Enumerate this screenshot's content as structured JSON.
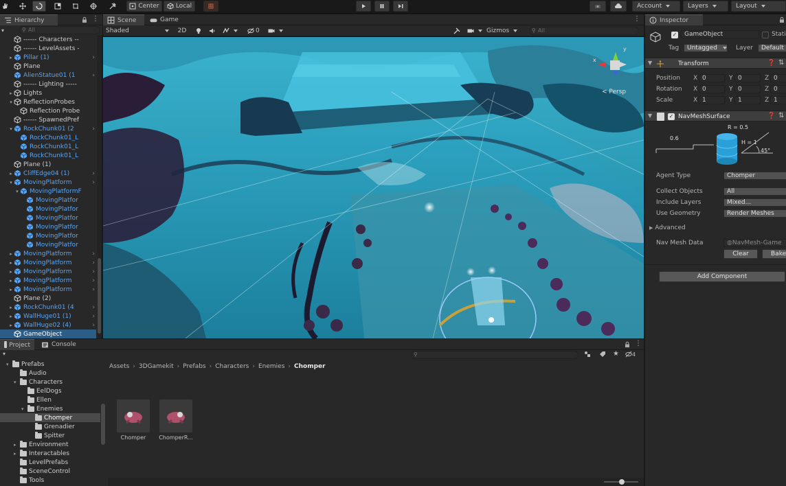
{
  "toolbar": {
    "center_label": "Center",
    "local_label": "Local",
    "account_label": "Account",
    "layers_label": "Layers",
    "layout_label": "Layout"
  },
  "hierarchy": {
    "tab_label": "Hierarchy",
    "search_placeholder": "All",
    "items": [
      {
        "label": "------ Characters --",
        "indent": 2,
        "blue": false,
        "arrow": ""
      },
      {
        "label": "------ LevelAssets -",
        "indent": 2,
        "blue": false,
        "arrow": ""
      },
      {
        "label": "Pillar (1)",
        "indent": 2,
        "blue": true,
        "arrow": "▶",
        "chev": true
      },
      {
        "label": "Plane",
        "indent": 2,
        "blue": false,
        "arrow": ""
      },
      {
        "label": "AlienStatue01 (1",
        "indent": 2,
        "blue": true,
        "arrow": "",
        "chev": true
      },
      {
        "label": "------ Lighting -----",
        "indent": 2,
        "blue": false,
        "arrow": ""
      },
      {
        "label": "Lights",
        "indent": 2,
        "blue": false,
        "arrow": "▶"
      },
      {
        "label": "ReflectionProbes",
        "indent": 2,
        "blue": false,
        "arrow": "▼"
      },
      {
        "label": "Reflection Probe",
        "indent": 3,
        "blue": false,
        "arrow": ""
      },
      {
        "label": "------ SpawnedPref",
        "indent": 2,
        "blue": false,
        "arrow": ""
      },
      {
        "label": "RockChunk01 (2",
        "indent": 2,
        "blue": true,
        "arrow": "▼",
        "chev": true
      },
      {
        "label": "RockChunk01_L",
        "indent": 3,
        "blue": true,
        "arrow": ""
      },
      {
        "label": "RockChunk01_L",
        "indent": 3,
        "blue": true,
        "arrow": ""
      },
      {
        "label": "RockChunk01_L",
        "indent": 3,
        "blue": true,
        "arrow": ""
      },
      {
        "label": "Plane (1)",
        "indent": 2,
        "blue": false,
        "arrow": ""
      },
      {
        "label": "CliffEdge04 (1)",
        "indent": 2,
        "blue": true,
        "arrow": "▶",
        "chev": true
      },
      {
        "label": "MovingPlatform",
        "indent": 2,
        "blue": true,
        "arrow": "▼",
        "chev": true
      },
      {
        "label": "MovingPlatformF",
        "indent": 3,
        "blue": true,
        "arrow": "▼"
      },
      {
        "label": "MovingPlatfor",
        "indent": 4,
        "blue": true,
        "arrow": ""
      },
      {
        "label": "MovingPlatfor",
        "indent": 4,
        "blue": true,
        "arrow": ""
      },
      {
        "label": "MovingPlatfor",
        "indent": 4,
        "blue": true,
        "arrow": ""
      },
      {
        "label": "MovingPlatfor",
        "indent": 4,
        "blue": true,
        "arrow": ""
      },
      {
        "label": "MovingPlatfor",
        "indent": 4,
        "blue": true,
        "arrow": ""
      },
      {
        "label": "MovingPlatfor",
        "indent": 4,
        "blue": true,
        "arrow": ""
      },
      {
        "label": "MovingPlatform",
        "indent": 2,
        "blue": true,
        "arrow": "▶",
        "chev": true
      },
      {
        "label": "MovingPlatform",
        "indent": 2,
        "blue": true,
        "arrow": "▶",
        "chev": true
      },
      {
        "label": "MovingPlatform",
        "indent": 2,
        "blue": true,
        "arrow": "▶",
        "chev": true
      },
      {
        "label": "MovingPlatform",
        "indent": 2,
        "blue": true,
        "arrow": "▶",
        "chev": true
      },
      {
        "label": "MovingPlatform",
        "indent": 2,
        "blue": true,
        "arrow": "▶",
        "chev": true
      },
      {
        "label": "Plane (2)",
        "indent": 2,
        "blue": false,
        "arrow": ""
      },
      {
        "label": "RockChunk01 (4",
        "indent": 2,
        "blue": true,
        "arrow": "▶",
        "chev": true
      },
      {
        "label": "WallHuge01 (1)",
        "indent": 2,
        "blue": true,
        "arrow": "▶",
        "chev": true
      },
      {
        "label": "WallHuge02 (4)",
        "indent": 2,
        "blue": true,
        "arrow": "▶",
        "chev": true
      },
      {
        "label": "GameObject",
        "indent": 2,
        "blue": false,
        "arrow": "",
        "selected": true
      }
    ]
  },
  "scene": {
    "tab_scene": "Scene",
    "tab_game": "Game",
    "shading_mode": "Shaded",
    "mode_2d": "2D",
    "effects_count": "0",
    "gizmos_label": "Gizmos",
    "search_placeholder": "All",
    "persp_label": "< Persp",
    "gizmo_y": "y",
    "gizmo_x": "x"
  },
  "inspector": {
    "tab_label": "Inspector",
    "object_name": "GameObject",
    "static_label": "Stati",
    "tag_label": "Tag",
    "tag_value": "Untagged",
    "layer_label": "Layer",
    "layer_value": "Default",
    "transform": {
      "title": "Transform",
      "position_label": "Position",
      "rotation_label": "Rotation",
      "scale_label": "Scale",
      "position": {
        "x": "0",
        "y": "0",
        "z": "0"
      },
      "rotation": {
        "x": "0",
        "y": "0",
        "z": "0"
      },
      "scale": {
        "x": "1",
        "y": "1",
        "z": "1"
      },
      "x_axis": "X",
      "y_axis": "Y",
      "z_axis": "Z"
    },
    "navmesh": {
      "title": "NavMeshSurface",
      "r_label": "R = 0.5",
      "h_label": "H = 1",
      "step_label": "0.6",
      "angle_label": "45°",
      "agent_type_label": "Agent Type",
      "agent_type_value": "Chomper",
      "collect_objects_label": "Collect Objects",
      "collect_objects_value": "All",
      "include_layers_label": "Include Layers",
      "include_layers_value": "Mixed...",
      "use_geometry_label": "Use Geometry",
      "use_geometry_value": "Render Meshes",
      "advanced_label": "Advanced",
      "nav_mesh_data_label": "Nav Mesh Data",
      "nav_mesh_data_value": "NavMesh-Game",
      "clear_button": "Clear",
      "bake_button": "Bake"
    },
    "add_component_button": "Add Component"
  },
  "project": {
    "tab_project": "Project",
    "tab_console": "Console",
    "hidden_count": "4",
    "breadcrumb": [
      "Assets",
      "3DGamekit",
      "Prefabs",
      "Characters",
      "Enemies",
      "Chomper"
    ],
    "tree": [
      {
        "label": "Prefabs",
        "indent": 1,
        "arrow": "▼"
      },
      {
        "label": "Audio",
        "indent": 2,
        "arrow": ""
      },
      {
        "label": "Characters",
        "indent": 2,
        "arrow": "▼"
      },
      {
        "label": "EelDogs",
        "indent": 3,
        "arrow": ""
      },
      {
        "label": "Ellen",
        "indent": 3,
        "arrow": ""
      },
      {
        "label": "Enemies",
        "indent": 3,
        "arrow": "▼"
      },
      {
        "label": "Chomper",
        "indent": 4,
        "arrow": "",
        "selected": true
      },
      {
        "label": "Grenadier",
        "indent": 4,
        "arrow": ""
      },
      {
        "label": "Spitter",
        "indent": 4,
        "arrow": ""
      },
      {
        "label": "Environment",
        "indent": 2,
        "arrow": "▶"
      },
      {
        "label": "Interactables",
        "indent": 2,
        "arrow": "▶"
      },
      {
        "label": "LevelPrefabs",
        "indent": 2,
        "arrow": ""
      },
      {
        "label": "SceneControl",
        "indent": 2,
        "arrow": ""
      },
      {
        "label": "Tools",
        "indent": 2,
        "arrow": ""
      }
    ],
    "assets": [
      {
        "label": "Chomper"
      },
      {
        "label": "ChomperR..."
      }
    ]
  },
  "colors": {
    "selection_blue": "#2c5d87",
    "prefab_blue": "#5aa6f5",
    "panel_bg": "#282828",
    "scene_water": "#1c6f88"
  }
}
